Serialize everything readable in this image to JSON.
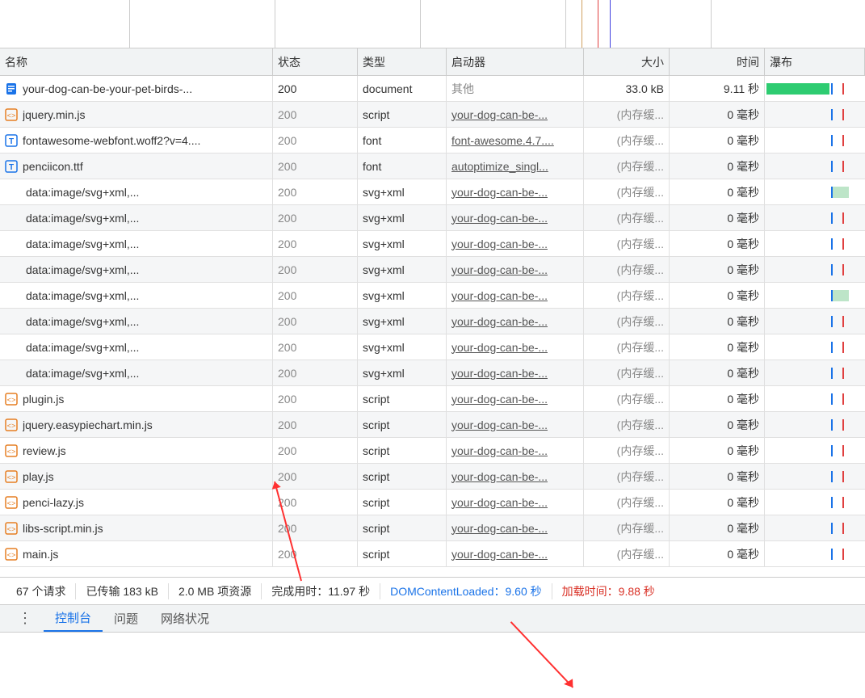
{
  "headers": {
    "name": "名称",
    "status": "状态",
    "type": "类型",
    "initiator": "启动器",
    "size": "大小",
    "time": "时间",
    "waterfall": "瀑布"
  },
  "rows": [
    {
      "icon": "document-icon",
      "iconColor": "#1a73e8",
      "name": "your-dog-can-be-your-pet-birds-...",
      "status": "200",
      "statusGray": false,
      "type": "document",
      "initiator": "其他",
      "initiatorOther": true,
      "size": "33.0 kB",
      "sizeGray": false,
      "time": "9.11 秒",
      "wf": "green",
      "indent": false
    },
    {
      "icon": "js-icon",
      "iconColor": "#e67e22",
      "name": "jquery.min.js",
      "status": "200",
      "statusGray": true,
      "type": "script",
      "initiator": "your-dog-can-be-...",
      "initiatorOther": false,
      "size": "(内存缓...",
      "sizeGray": true,
      "time": "0 毫秒",
      "wf": "blue",
      "indent": false
    },
    {
      "icon": "font-icon",
      "iconColor": "#1a73e8",
      "name": "fontawesome-webfont.woff2?v=4....",
      "status": "200",
      "statusGray": true,
      "type": "font",
      "initiator": "font-awesome.4.7....",
      "initiatorOther": false,
      "size": "(内存缓...",
      "sizeGray": true,
      "time": "0 毫秒",
      "wf": "blue",
      "indent": false
    },
    {
      "icon": "font-icon",
      "iconColor": "#1a73e8",
      "name": "penciicon.ttf",
      "status": "200",
      "statusGray": true,
      "type": "font",
      "initiator": "autoptimize_singl...",
      "initiatorOther": false,
      "size": "(内存缓...",
      "sizeGray": true,
      "time": "0 毫秒",
      "wf": "blue",
      "indent": false
    },
    {
      "icon": "",
      "name": "data:image/svg+xml,...",
      "status": "200",
      "statusGray": true,
      "type": "svg+xml",
      "initiator": "your-dog-can-be-...",
      "initiatorOther": false,
      "size": "(内存缓...",
      "sizeGray": true,
      "time": "0 毫秒",
      "wf": "green2",
      "indent": true
    },
    {
      "icon": "",
      "name": "data:image/svg+xml,...",
      "status": "200",
      "statusGray": true,
      "type": "svg+xml",
      "initiator": "your-dog-can-be-...",
      "initiatorOther": false,
      "size": "(内存缓...",
      "sizeGray": true,
      "time": "0 毫秒",
      "wf": "blue",
      "indent": true
    },
    {
      "icon": "",
      "name": "data:image/svg+xml,...",
      "status": "200",
      "statusGray": true,
      "type": "svg+xml",
      "initiator": "your-dog-can-be-...",
      "initiatorOther": false,
      "size": "(内存缓...",
      "sizeGray": true,
      "time": "0 毫秒",
      "wf": "blue",
      "indent": true
    },
    {
      "icon": "",
      "name": "data:image/svg+xml,...",
      "status": "200",
      "statusGray": true,
      "type": "svg+xml",
      "initiator": "your-dog-can-be-...",
      "initiatorOther": false,
      "size": "(内存缓...",
      "sizeGray": true,
      "time": "0 毫秒",
      "wf": "blue",
      "indent": true
    },
    {
      "icon": "",
      "name": "data:image/svg+xml,...",
      "status": "200",
      "statusGray": true,
      "type": "svg+xml",
      "initiator": "your-dog-can-be-...",
      "initiatorOther": false,
      "size": "(内存缓...",
      "sizeGray": true,
      "time": "0 毫秒",
      "wf": "green2",
      "indent": true
    },
    {
      "icon": "",
      "name": "data:image/svg+xml,...",
      "status": "200",
      "statusGray": true,
      "type": "svg+xml",
      "initiator": "your-dog-can-be-...",
      "initiatorOther": false,
      "size": "(内存缓...",
      "sizeGray": true,
      "time": "0 毫秒",
      "wf": "blue",
      "indent": true
    },
    {
      "icon": "",
      "name": "data:image/svg+xml,...",
      "status": "200",
      "statusGray": true,
      "type": "svg+xml",
      "initiator": "your-dog-can-be-...",
      "initiatorOther": false,
      "size": "(内存缓...",
      "sizeGray": true,
      "time": "0 毫秒",
      "wf": "blue",
      "indent": true
    },
    {
      "icon": "",
      "name": "data:image/svg+xml,...",
      "status": "200",
      "statusGray": true,
      "type": "svg+xml",
      "initiator": "your-dog-can-be-...",
      "initiatorOther": false,
      "size": "(内存缓...",
      "sizeGray": true,
      "time": "0 毫秒",
      "wf": "blue",
      "indent": true
    },
    {
      "icon": "js-icon",
      "iconColor": "#e67e22",
      "name": "plugin.js",
      "status": "200",
      "statusGray": true,
      "type": "script",
      "initiator": "your-dog-can-be-...",
      "initiatorOther": false,
      "size": "(内存缓...",
      "sizeGray": true,
      "time": "0 毫秒",
      "wf": "blue",
      "indent": false
    },
    {
      "icon": "js-icon",
      "iconColor": "#e67e22",
      "name": "jquery.easypiechart.min.js",
      "status": "200",
      "statusGray": true,
      "type": "script",
      "initiator": "your-dog-can-be-...",
      "initiatorOther": false,
      "size": "(内存缓...",
      "sizeGray": true,
      "time": "0 毫秒",
      "wf": "blue",
      "indent": false
    },
    {
      "icon": "js-icon",
      "iconColor": "#e67e22",
      "name": "review.js",
      "status": "200",
      "statusGray": true,
      "type": "script",
      "initiator": "your-dog-can-be-...",
      "initiatorOther": false,
      "size": "(内存缓...",
      "sizeGray": true,
      "time": "0 毫秒",
      "wf": "blue",
      "indent": false
    },
    {
      "icon": "js-icon",
      "iconColor": "#e67e22",
      "name": "play.js",
      "status": "200",
      "statusGray": true,
      "type": "script",
      "initiator": "your-dog-can-be-...",
      "initiatorOther": false,
      "size": "(内存缓...",
      "sizeGray": true,
      "time": "0 毫秒",
      "wf": "blue",
      "indent": false
    },
    {
      "icon": "js-icon",
      "iconColor": "#e67e22",
      "name": "penci-lazy.js",
      "status": "200",
      "statusGray": true,
      "type": "script",
      "initiator": "your-dog-can-be-...",
      "initiatorOther": false,
      "size": "(内存缓...",
      "sizeGray": true,
      "time": "0 毫秒",
      "wf": "blue",
      "indent": false
    },
    {
      "icon": "js-icon",
      "iconColor": "#e67e22",
      "name": "libs-script.min.js",
      "status": "200",
      "statusGray": true,
      "type": "script",
      "initiator": "your-dog-can-be-...",
      "initiatorOther": false,
      "size": "(内存缓...",
      "sizeGray": true,
      "time": "0 毫秒",
      "wf": "blue",
      "indent": false
    },
    {
      "icon": "js-icon",
      "iconColor": "#e67e22",
      "name": "main.js",
      "status": "200",
      "statusGray": true,
      "type": "script",
      "initiator": "your-dog-can-be-...",
      "initiatorOther": false,
      "size": "(内存缓...",
      "sizeGray": true,
      "time": "0 毫秒",
      "wf": "blue",
      "indent": false
    }
  ],
  "summary": {
    "requests": "67 个请求",
    "transferred": "已传输 183 kB",
    "resources": "2.0 MB 项资源",
    "finish": "完成用时：11.97 秒",
    "dcl": "DOMContentLoaded：9.60 秒",
    "load": "加载时间：9.88 秒"
  },
  "tabs": {
    "console": "控制台",
    "issues": "问题",
    "network_conditions": "网络状况"
  }
}
